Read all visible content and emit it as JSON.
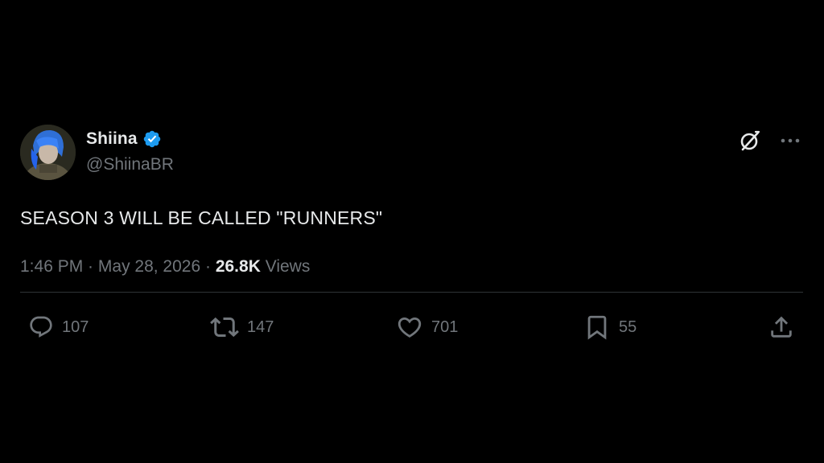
{
  "author": {
    "display_name": "Shiina",
    "handle": "@ShiinaBR",
    "verified": true,
    "verified_icon": "verified-badge-icon",
    "verified_color": "#1d9bf0"
  },
  "header_icons": {
    "grok": "grok-icon",
    "more": "more-options-icon"
  },
  "tweet": {
    "text": "SEASON 3 WILL BE CALLED \"RUNNERS\"",
    "time": "1:46 PM",
    "sep1": " · ",
    "date": "May 28, 2026",
    "sep2": " · ",
    "views_count": "26.8K",
    "views_label": " Views"
  },
  "actions": {
    "reply": {
      "icon": "reply-icon",
      "count": "107"
    },
    "retweet": {
      "icon": "retweet-icon",
      "count": "147"
    },
    "like": {
      "icon": "like-icon",
      "count": "701"
    },
    "bookmark": {
      "icon": "bookmark-icon",
      "count": "55"
    },
    "share": {
      "icon": "share-icon"
    }
  },
  "colors": {
    "background": "#000000",
    "text_primary": "#e7e9ea",
    "text_secondary": "#71767b",
    "divider": "#2f3336"
  }
}
